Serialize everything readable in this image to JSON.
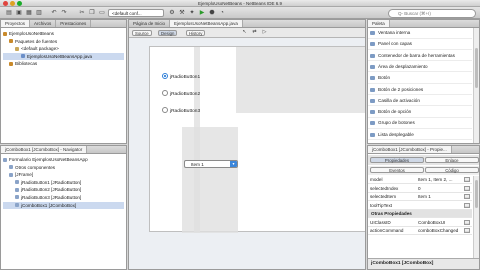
{
  "window": {
    "title": "EjemploUsoNetBeans - NetBeans IDE 6.9"
  },
  "toolbar": {
    "config": "<default conf...",
    "search_placeholder": "Q- Buscar (⌘+I)"
  },
  "left_tabs": [
    "Proyectos",
    "Archivos",
    "Prestaciones"
  ],
  "project_tree": [
    {
      "label": "EjemploUsoNetBeans",
      "indent": 0,
      "icon_color": "#c98a2b"
    },
    {
      "label": "Paquetes de fuentes",
      "indent": 1,
      "icon_color": "#c98a2b"
    },
    {
      "label": "<default package>",
      "indent": 2,
      "icon_color": "#c9a85a"
    },
    {
      "label": "EjemplosUsoNetBeansApp.java",
      "indent": 3,
      "icon_color": "#6b8fc9",
      "selected": true
    },
    {
      "label": "Bibliotecas",
      "indent": 1,
      "icon_color": "#c98a2b"
    }
  ],
  "navigator": {
    "title": "jComboBox1 [JComboBox] - Navigator",
    "items": [
      {
        "label": "Formulario EjemplosUsoNetBeansApp",
        "indent": 0
      },
      {
        "label": "Otros componentes",
        "indent": 1
      },
      {
        "label": "[JFrame]",
        "indent": 1
      },
      {
        "label": "jRadioButton1 [JRadioButton]",
        "indent": 2
      },
      {
        "label": "jRadioButton2 [JRadioButton]",
        "indent": 2
      },
      {
        "label": "jRadioButton3 [JRadioButton]",
        "indent": 2
      },
      {
        "label": "jComboBox1 [JComboBox]",
        "indent": 2,
        "selected": true
      }
    ]
  },
  "editor": {
    "tabs": [
      "Página de Inicio",
      "EjemplosUsoNetBeansApp.java"
    ],
    "source_btn": "Source",
    "design_btn": "Design",
    "history_btn": "History"
  },
  "form": {
    "radios": [
      {
        "label": "jRadioButton1",
        "checked": true
      },
      {
        "label": "jRadioButton2",
        "checked": false
      },
      {
        "label": "jRadioButton3",
        "checked": false
      }
    ],
    "combo_value": "Item 1"
  },
  "palette": {
    "title": "Paleta",
    "items": [
      "Ventana interna",
      "Panel con capas",
      "Contenedor de barra de herramientas",
      "Área de desplazamiento",
      "Botón",
      "Botón de 2 posiciones",
      "Casilla de activación",
      "Botón de opción",
      "Grupo de botones",
      "Lista desplegable"
    ]
  },
  "properties": {
    "title": "jComboBox1 [JComboBox] - Propie...",
    "tab_properties": "Propiedades",
    "tab_link": "Enlace",
    "sub_events": "Eventos",
    "sub_code": "Código",
    "rows": [
      {
        "key": "model",
        "value": "Item 1, Item 2, ..."
      },
      {
        "key": "selectedIndex",
        "value": "0"
      },
      {
        "key": "selectedItem",
        "value": "Item 1"
      },
      {
        "key": "toolTipText",
        "value": ""
      }
    ],
    "section": "Otras Propiedades",
    "rows2": [
      {
        "key": "UIClassID",
        "value": "ComboBoxUI"
      },
      {
        "key": "actionCommand",
        "value": "comboBoxChanged"
      }
    ],
    "footer": "jComboBox1 [JComboBox]"
  }
}
